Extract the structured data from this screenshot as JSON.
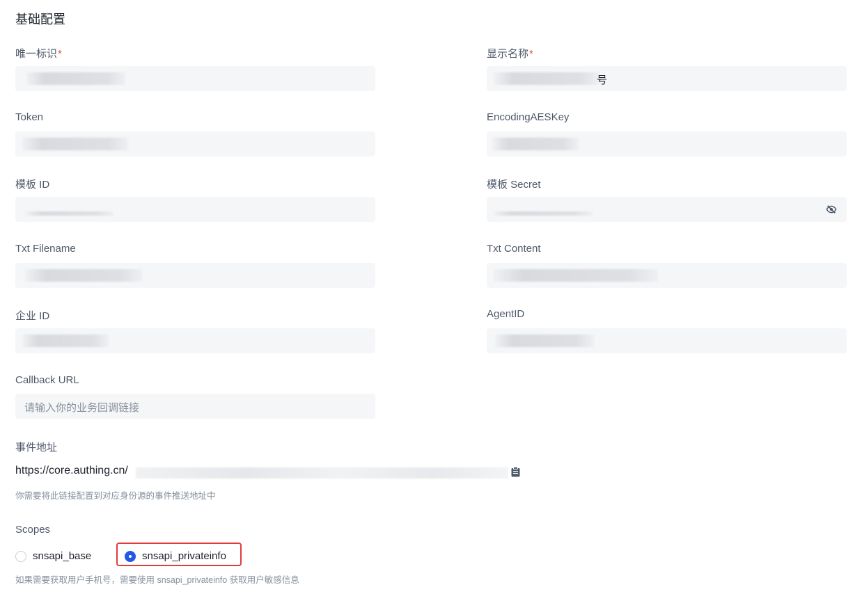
{
  "section_title": "基础配置",
  "fields": {
    "unique_id": {
      "label": "唯一标识",
      "required_mark": "*"
    },
    "display_name": {
      "label": "显示名称",
      "required_mark": "*",
      "visible_char": "号"
    },
    "token": {
      "label": "Token"
    },
    "encoding_aes_key": {
      "label": "EncodingAESKey"
    },
    "template_id": {
      "label": "模板 ID"
    },
    "template_secret": {
      "label": "模板 Secret"
    },
    "txt_filename": {
      "label": "Txt Filename"
    },
    "txt_content": {
      "label": "Txt Content"
    },
    "corp_id": {
      "label": "企业 ID"
    },
    "agent_id": {
      "label": "AgentID"
    },
    "callback_url": {
      "label": "Callback URL",
      "placeholder": "请输入你的业务回调链接"
    }
  },
  "event": {
    "label": "事件地址",
    "url_prefix": "https://core.authing.cn/",
    "hint": "你需要将此链接配置到对应身份源的事件推送地址中"
  },
  "scopes": {
    "label": "Scopes",
    "options": [
      {
        "label": "snsapi_base",
        "checked": false
      },
      {
        "label": "snsapi_privateinfo",
        "checked": true
      }
    ],
    "hint": "如果需要获取用户手机号，需要使用 snsapi_privateinfo 获取用户敏感信息"
  },
  "colors": {
    "accent": "#215ae5",
    "highlight": "#e03c3c",
    "input_bg": "#f5f6f8"
  },
  "icons": [
    "eye-off-icon",
    "copy-icon"
  ]
}
